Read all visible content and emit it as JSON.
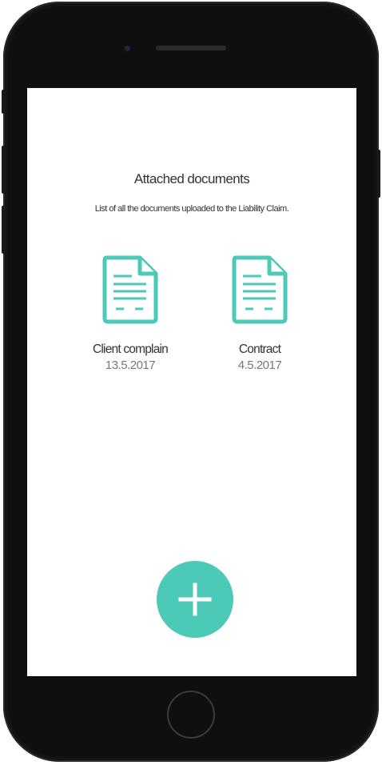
{
  "page": {
    "title": "Attached documents",
    "subtitle": "List of all the documents uploaded to the Liability Claim."
  },
  "documents": [
    {
      "name": "Client complain",
      "date": "13.5.2017",
      "icon": "document-icon"
    },
    {
      "name": "Contract",
      "date": "4.5.2017",
      "icon": "document-icon"
    }
  ],
  "fab": {
    "icon": "plus-icon"
  },
  "colors": {
    "accent": "#4dc9b7",
    "text": "#333333",
    "muted": "#777777",
    "frame": "#0f0f0f"
  }
}
